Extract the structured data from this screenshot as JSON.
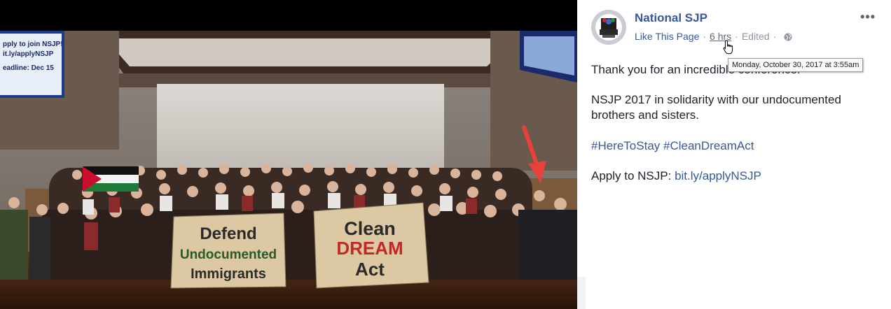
{
  "post": {
    "page_name": "National SJP",
    "like_page": "Like This Page",
    "separator": "·",
    "timestamp": "6 hrs",
    "edited": "Edited",
    "more_label": "•••",
    "tooltip": "Monday, October 30, 2017 at 3:55am",
    "line1": "Thank you for an incredible conference!",
    "line2": "NSJP 2017 in solidarity with our undocumented brothers and sisters.",
    "hashtag1": "#HereToStay",
    "hashtag2": "#CleanDreamAct",
    "apply_prefix": "Apply to NSJP: ",
    "apply_link": "bit.ly/applyNSJP"
  },
  "photo": {
    "screen_left_line1": "pply to join NSJP!",
    "screen_left_line2": "it.ly/applyNSJP",
    "screen_left_line3": "eadline: Dec 15",
    "banner1_line1": "Defend",
    "banner1_line2": "Undocumented",
    "banner1_line3": "Immigrants",
    "banner2_line1": "Clean",
    "banner2_line2": "DREAM",
    "banner2_line3": "Act"
  },
  "colors": {
    "link": "#365899",
    "text": "#1d2129",
    "meta": "#90949c",
    "arrow": "#e8403a"
  }
}
